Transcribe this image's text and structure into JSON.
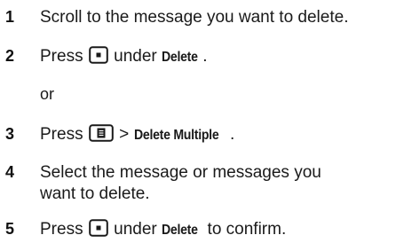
{
  "steps": [
    {
      "number": "1",
      "text": "Scroll to the message you want to delete."
    },
    {
      "number": "2",
      "pre": "Press",
      "key_icon": "center-select-key-icon",
      "mid": "under",
      "key": "Delete",
      "post": "."
    },
    {
      "or": "or"
    },
    {
      "number": "3",
      "pre": "Press",
      "key_icon": "menu-key-icon",
      "mid": ">",
      "key": "Delete Multiple",
      "post": "."
    },
    {
      "number": "4",
      "line1": "Select the message or messages you",
      "line2": "want to delete."
    },
    {
      "number": "5",
      "pre": "Press",
      "key_icon": "center-select-key-icon",
      "mid": "under",
      "key": "Delete",
      "post": "to confirm."
    }
  ]
}
